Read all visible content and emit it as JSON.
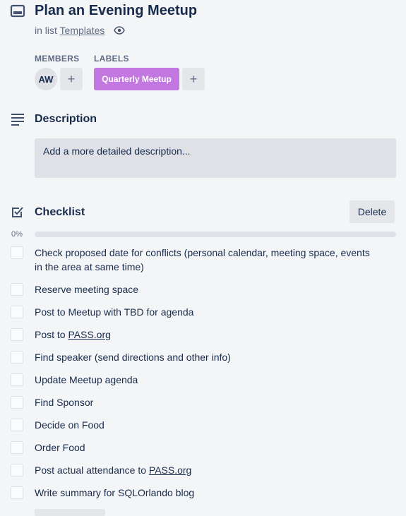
{
  "card": {
    "title": "Plan an Evening Meetup",
    "in_list_prefix": "in list",
    "list_name": "Templates"
  },
  "members": {
    "heading": "MEMBERS",
    "avatar_initials": "AW",
    "add_label": "+"
  },
  "labels": {
    "heading": "LABELS",
    "items": [
      {
        "name": "Quarterly Meetup",
        "color": "#c377e0"
      }
    ],
    "add_label": "+"
  },
  "description": {
    "title": "Description",
    "placeholder": "Add a more detailed description..."
  },
  "checklist": {
    "title": "Checklist",
    "delete_label": "Delete",
    "progress_text": "0%",
    "progress": 0,
    "items": [
      {
        "text": "Check proposed date for conflicts (personal calendar, meeting space, events in the area at same time)",
        "checked": false
      },
      {
        "text": "Reserve meeting space",
        "checked": false
      },
      {
        "text": "Post to Meetup with TBD for agenda",
        "checked": false
      },
      {
        "text_before": "Post to ",
        "link": "PASS.org",
        "checked": false
      },
      {
        "text": "Find speaker (send directions and other info)",
        "checked": false
      },
      {
        "text": "Update Meetup agenda",
        "checked": false
      },
      {
        "text": "Find Sponsor",
        "checked": false
      },
      {
        "text": "Decide on Food",
        "checked": false
      },
      {
        "text": "Order Food",
        "checked": false
      },
      {
        "text_before": "Post actual attendance to ",
        "link": "PASS.org",
        "checked": false
      },
      {
        "text": "Write summary for SQLOrlando blog",
        "checked": false
      }
    ]
  },
  "colors": {
    "background": "#f4f5f7",
    "text": "#172b4d",
    "muted": "#5e6c84",
    "label_purple": "#c377e0"
  },
  "icons": [
    "card-icon",
    "eye-icon",
    "description-icon",
    "checklist-icon"
  ]
}
